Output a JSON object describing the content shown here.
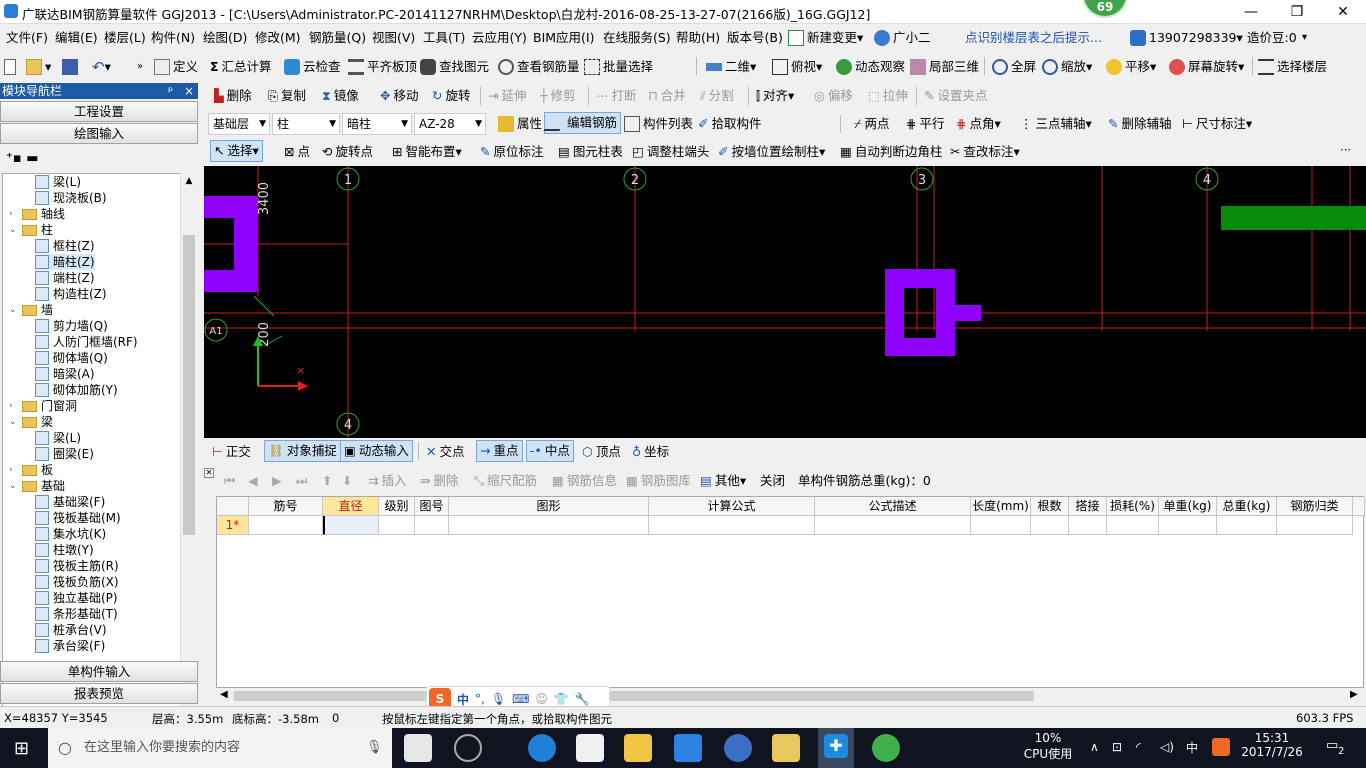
{
  "window": {
    "title": "广联达BIM钢筋算量软件 GGJ2013 - [C:\\Users\\Administrator.PC-20141127NRHM\\Desktop\\白龙村-2016-08-25-13-27-07(2166版)_16G.GGJ12]",
    "badge": "69",
    "min": "—",
    "max": "❐",
    "close": "✕"
  },
  "menubar": {
    "items": [
      "文件(F)",
      "编辑(E)",
      "楼层(L)",
      "构件(N)",
      "绘图(D)",
      "修改(M)",
      "钢筋量(Q)",
      "视图(V)",
      "工具(T)",
      "云应用(Y)",
      "BIM应用(I)",
      "在线服务(S)",
      "帮助(H)",
      "版本号(B)",
      "新建变更",
      "广小二"
    ],
    "hint": "点识别楼层表之后提示...",
    "phone": "13907298339",
    "cost": "造价豆:0"
  },
  "toolbar1": {
    "items": [
      "定义",
      "汇总计算",
      "云检查",
      "平齐板顶",
      "查找图元",
      "查看钢筋量",
      "批量选择",
      "二维",
      "俯视",
      "动态观察",
      "局部三维",
      "全屏",
      "缩放",
      "平移",
      "屏幕旋转",
      "选择楼层"
    ]
  },
  "toolbar2": {
    "items": [
      "删除",
      "复制",
      "镜像",
      "移动",
      "旋转",
      "延伸",
      "修剪",
      "打断",
      "合并",
      "分割",
      "对齐",
      "偏移",
      "拉伸",
      "设置夹点"
    ]
  },
  "toolbar3": {
    "combo_floor": "基础层",
    "combo_type": "柱",
    "combo_sub": "暗柱",
    "combo_item": "AZ-28",
    "items": [
      "属性",
      "编辑钢筋",
      "构件列表",
      "拾取构件",
      "两点",
      "平行",
      "点角",
      "三点辅轴",
      "删除辅轴",
      "尺寸标注"
    ]
  },
  "toolbar4": {
    "items": [
      "选择",
      "点",
      "旋转点",
      "智能布置",
      "原位标注",
      "图元柱表",
      "调整柱端头",
      "按墙位置绘制柱",
      "自动判断边角柱",
      "查改标注"
    ]
  },
  "nav": {
    "title": "模块导航栏",
    "pin": "ᵖ",
    "close": "×",
    "btn_settings": "工程设置",
    "btn_draw": "绘图输入",
    "btn_single": "单构件输入",
    "btn_report": "报表预览",
    "tree": [
      {
        "label": "梁(L)",
        "level": 2,
        "type": "comp"
      },
      {
        "label": "现浇板(B)",
        "level": 2,
        "type": "comp"
      },
      {
        "label": "轴线",
        "level": 1,
        "type": "folder",
        "exp": "›"
      },
      {
        "label": "柱",
        "level": 1,
        "type": "folder",
        "exp": "⌄"
      },
      {
        "label": "框柱(Z)",
        "level": 2,
        "type": "comp"
      },
      {
        "label": "暗柱(Z)",
        "level": 2,
        "type": "comp",
        "selected": true
      },
      {
        "label": "端柱(Z)",
        "level": 2,
        "type": "comp"
      },
      {
        "label": "构造柱(Z)",
        "level": 2,
        "type": "comp"
      },
      {
        "label": "墙",
        "level": 1,
        "type": "folder",
        "exp": "⌄"
      },
      {
        "label": "剪力墙(Q)",
        "level": 2,
        "type": "comp"
      },
      {
        "label": "人防门框墙(RF)",
        "level": 2,
        "type": "comp"
      },
      {
        "label": "砌体墙(Q)",
        "level": 2,
        "type": "comp"
      },
      {
        "label": "暗梁(A)",
        "level": 2,
        "type": "comp"
      },
      {
        "label": "砌体加筋(Y)",
        "level": 2,
        "type": "comp"
      },
      {
        "label": "门窗洞",
        "level": 1,
        "type": "folder",
        "exp": "›"
      },
      {
        "label": "梁",
        "level": 1,
        "type": "folder",
        "exp": "⌄"
      },
      {
        "label": "梁(L)",
        "level": 2,
        "type": "comp"
      },
      {
        "label": "圈梁(E)",
        "level": 2,
        "type": "comp"
      },
      {
        "label": "板",
        "level": 1,
        "type": "folder",
        "exp": "›"
      },
      {
        "label": "基础",
        "level": 1,
        "type": "folder",
        "exp": "⌄"
      },
      {
        "label": "基础梁(F)",
        "level": 2,
        "type": "comp"
      },
      {
        "label": "筏板基础(M)",
        "level": 2,
        "type": "comp"
      },
      {
        "label": "集水坑(K)",
        "level": 2,
        "type": "comp"
      },
      {
        "label": "柱墩(Y)",
        "level": 2,
        "type": "comp"
      },
      {
        "label": "筏板主筋(R)",
        "level": 2,
        "type": "comp"
      },
      {
        "label": "筏板负筋(X)",
        "level": 2,
        "type": "comp"
      },
      {
        "label": "独立基础(P)",
        "level": 2,
        "type": "comp"
      },
      {
        "label": "条形基础(T)",
        "level": 2,
        "type": "comp"
      },
      {
        "label": "桩承台(V)",
        "level": 2,
        "type": "comp"
      },
      {
        "label": "承台梁(F)",
        "level": 2,
        "type": "comp"
      }
    ]
  },
  "canvas": {
    "axis_labels": [
      "1",
      "2",
      "3",
      "4"
    ],
    "bottom_axis": "4",
    "dim_top": "3400",
    "dim_left": "200",
    "origin_label": "A1"
  },
  "snapbar": {
    "items": [
      "正交",
      "对象捕捉",
      "动态输入",
      "交点",
      "重点",
      "中点",
      "顶点",
      "坐标"
    ]
  },
  "gridtoolbar": {
    "items": [
      "插入",
      "删除",
      "缩尺配筋",
      "钢筋信息",
      "钢筋图库",
      "其他",
      "关闭"
    ],
    "total": "单构件钢筋总重(kg)：0"
  },
  "grid": {
    "columns": [
      "筋号",
      "直径(mm)",
      "级别",
      "图号",
      "图形",
      "计算公式",
      "公式描述",
      "长度(mm)",
      "根数",
      "搭接",
      "损耗(%)",
      "单重(kg)",
      "总重(kg)",
      "钢筋归类"
    ],
    "row_label": "1*"
  },
  "ime": {
    "lang": "中",
    "punc": "°,"
  },
  "status": {
    "coords": "X=48357 Y=3545",
    "floor_height": "层高：3.55m",
    "bottom_height": "底标高：-3.58m",
    "val": "0",
    "prompt": "按鼠标左键指定第一个角点，或拾取构件图元",
    "fps": "603.3 FPS"
  },
  "taskbar": {
    "search_placeholder": "在这里输入你要搜索的内容",
    "cpu_pct": "10%",
    "cpu_label": "CPU使用",
    "time": "15:31",
    "date": "2017/7/26",
    "ime": "中",
    "notif": "2"
  },
  "colors": {
    "canvas_bg": "#000000",
    "wall_purple": "#8f00ff",
    "axis_red": "#d42020",
    "green_block": "#0a8a0a",
    "nav_head": "#1c5aa6"
  }
}
